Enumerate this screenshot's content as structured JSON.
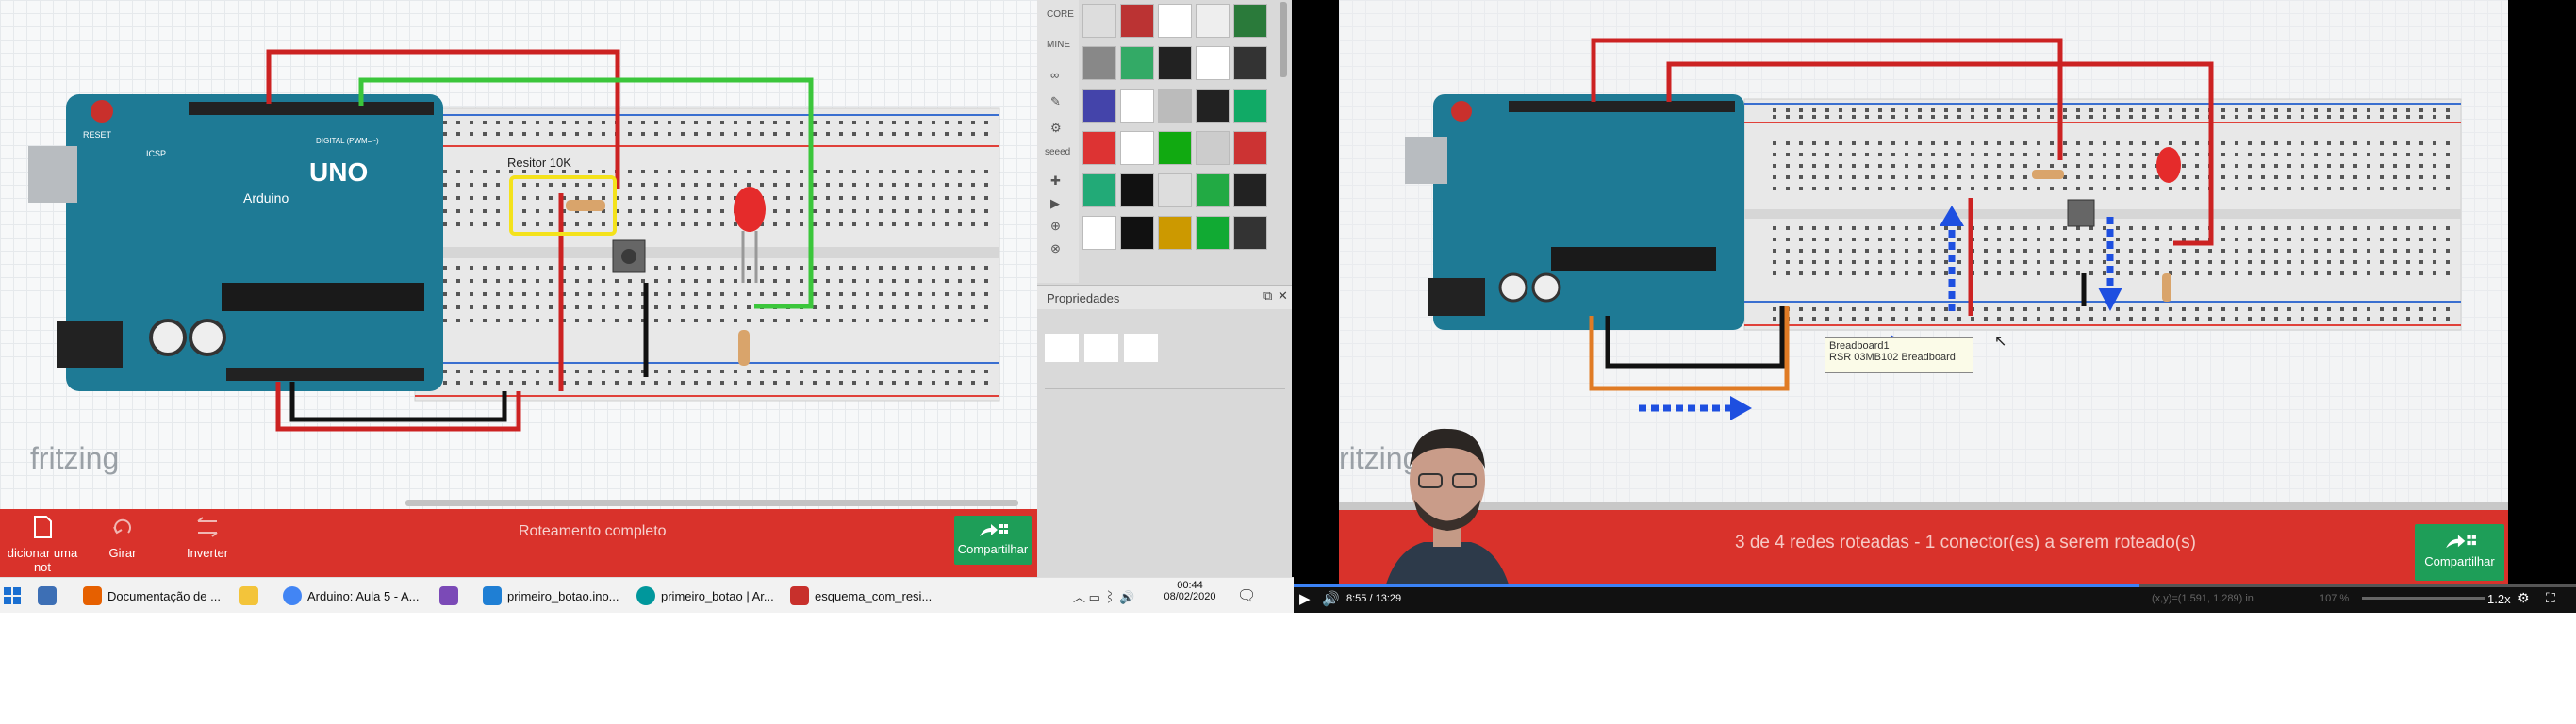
{
  "left_app": {
    "brand": "fritzing",
    "resistor_label": "Resitor 10K",
    "board_label": "UNO",
    "board_brand": "Arduino",
    "board_text": "DIGITAL (PWM=~)",
    "reset_label": "RESET",
    "icsp_label": "ICSP",
    "tools": [
      {
        "label": "dicionar uma not",
        "icon": "note-icon"
      },
      {
        "label": "Girar",
        "icon": "rotate-icon"
      },
      {
        "label": "Inverter",
        "icon": "flip-icon"
      }
    ],
    "routing_status": "Roteamento completo",
    "share_label": "Compartilhar"
  },
  "parts_panel": {
    "categories": [
      "CORE",
      "MINE",
      "∞",
      "✎",
      "⚙",
      "seeed",
      "✚",
      "▶",
      "⊕",
      "⊗"
    ],
    "properties_title": "Propriedades"
  },
  "taskbar": {
    "items": [
      {
        "label": "Documentação de ...",
        "icon": "firefox-icon",
        "color": "#e66000"
      },
      {
        "label": "",
        "icon": "folder-icon",
        "color": "#f3c43a"
      },
      {
        "label": "Arduino: Aula 5 - A...",
        "icon": "chrome-icon",
        "color": "#4285f4"
      },
      {
        "label": "",
        "icon": "visual-studio-icon",
        "color": "#7b4ab7"
      },
      {
        "label": "primeiro_botao.ino...",
        "icon": "vscode-icon",
        "color": "#1f7fd4"
      },
      {
        "label": "primeiro_botao | Ar...",
        "icon": "arduino-icon",
        "color": "#00979c"
      },
      {
        "label": "esquema_com_resi...",
        "icon": "fritzing-icon",
        "color": "#c8302c"
      }
    ],
    "time": "00:44",
    "date": "08/02/2020"
  },
  "right_app": {
    "brand": "ritzing",
    "routing_status": "3 de 4 redes roteadas - 1 conector(es) a serem roteado(s)",
    "share_label": "Compartilhar",
    "tooltip_title": "Breadboard1",
    "tooltip_sub": "RSR 03MB102 Breadboard",
    "coords": "(x,y)=(1.591, 1.289) in",
    "zoom_pct": "107 %"
  },
  "player": {
    "time": "8:55 / 13:29",
    "speed": "1.2x",
    "progress": 0.66
  },
  "colors": {
    "red_bar": "#d9322b",
    "share_green": "#1e9e58",
    "arduino_teal": "#1e7a95"
  }
}
